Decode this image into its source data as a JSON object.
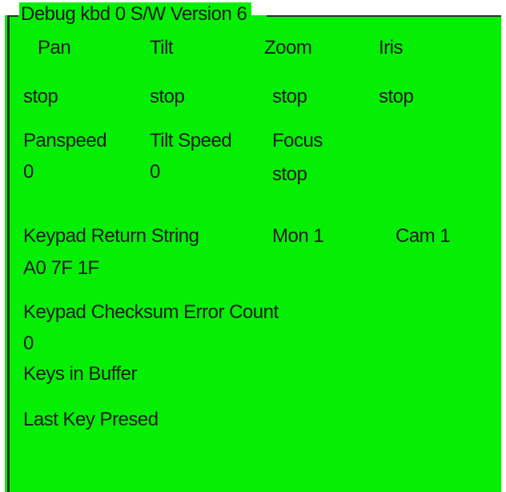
{
  "groupbox": {
    "title": "Debug kbd 0 S/W  Version 6"
  },
  "pan": {
    "label": "Pan",
    "value": "stop"
  },
  "tilt": {
    "label": "Tilt",
    "value": "stop"
  },
  "zoom": {
    "label": "Zoom",
    "value": "stop"
  },
  "iris": {
    "label": "Iris",
    "value": "stop"
  },
  "panspeed": {
    "label": "Panspeed",
    "value": "0"
  },
  "tilt_speed": {
    "label": "Tilt Speed",
    "value": "0"
  },
  "focus": {
    "label": "Focus",
    "value": "stop"
  },
  "keypad_return": {
    "label": "Keypad Return String",
    "value": "A0 7F 1F"
  },
  "monitor": "Mon 1",
  "camera": "Cam 1",
  "checksum": {
    "label": "Keypad Checksum Error Count",
    "value": "0"
  },
  "keys_in_buffer": {
    "label": "Keys in Buffer"
  },
  "last_key": {
    "label": "Last Key Presed"
  },
  "colors": {
    "panel_background": "#05ef05",
    "frame": "#2f2f2f",
    "text": "#1c1c1c"
  }
}
